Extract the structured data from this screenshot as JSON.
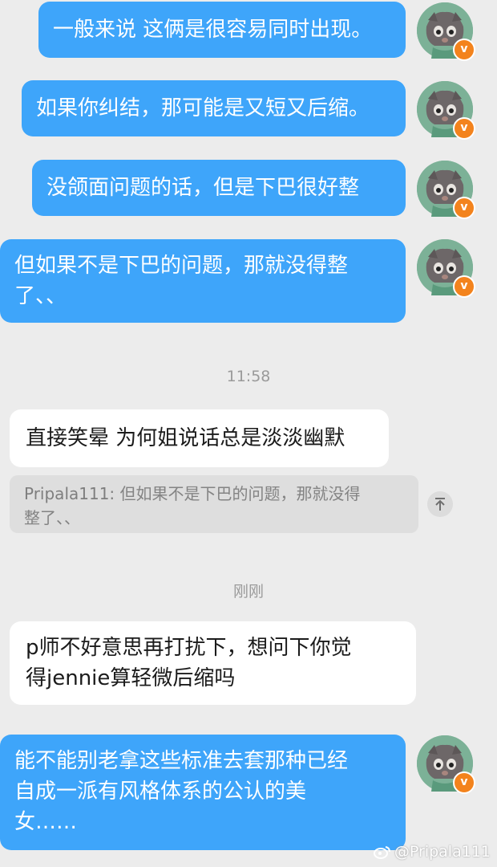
{
  "outgoing_messages": [
    {
      "text": "一般来说 这俩是很容易同时出现。"
    },
    {
      "text": "如果你纠结，那可能是又短又后缩。"
    },
    {
      "text": "没颌面问题的话，但是下巴很好整"
    },
    {
      "text": "但如果不是下巴的问题，那就没得整\n了、、"
    },
    {
      "text": "能不能别老拿这些标准去套那种已经\n自成一派有风格体系的公认的美\n女……"
    }
  ],
  "timestamps": {
    "first": "11:58",
    "second": "刚刚"
  },
  "incoming_messages": [
    {
      "text": "直接笑晕 为何姐说话总是淡淡幽默"
    },
    {
      "text": "p师不好意思再打扰下，想问下你觉\n得jennie算轻微后缩吗"
    }
  ],
  "quote": {
    "name": "Pripala111:",
    "text": " 但如果不是下巴的问题，那就没得\n整了、、"
  },
  "avatar": {
    "badge": "v",
    "badge_color": "#f3831d"
  },
  "watermark": "@Pripala111",
  "colors": {
    "bubble_out": "#3ea5fa",
    "bubble_in": "#ffffff",
    "background": "#ececec"
  },
  "icons": {
    "avatar": "cartoon-cat-avatar",
    "badge": "verified-badge",
    "scroll": "scroll-to-top-icon",
    "watermark": "weibo-logo-icon"
  }
}
